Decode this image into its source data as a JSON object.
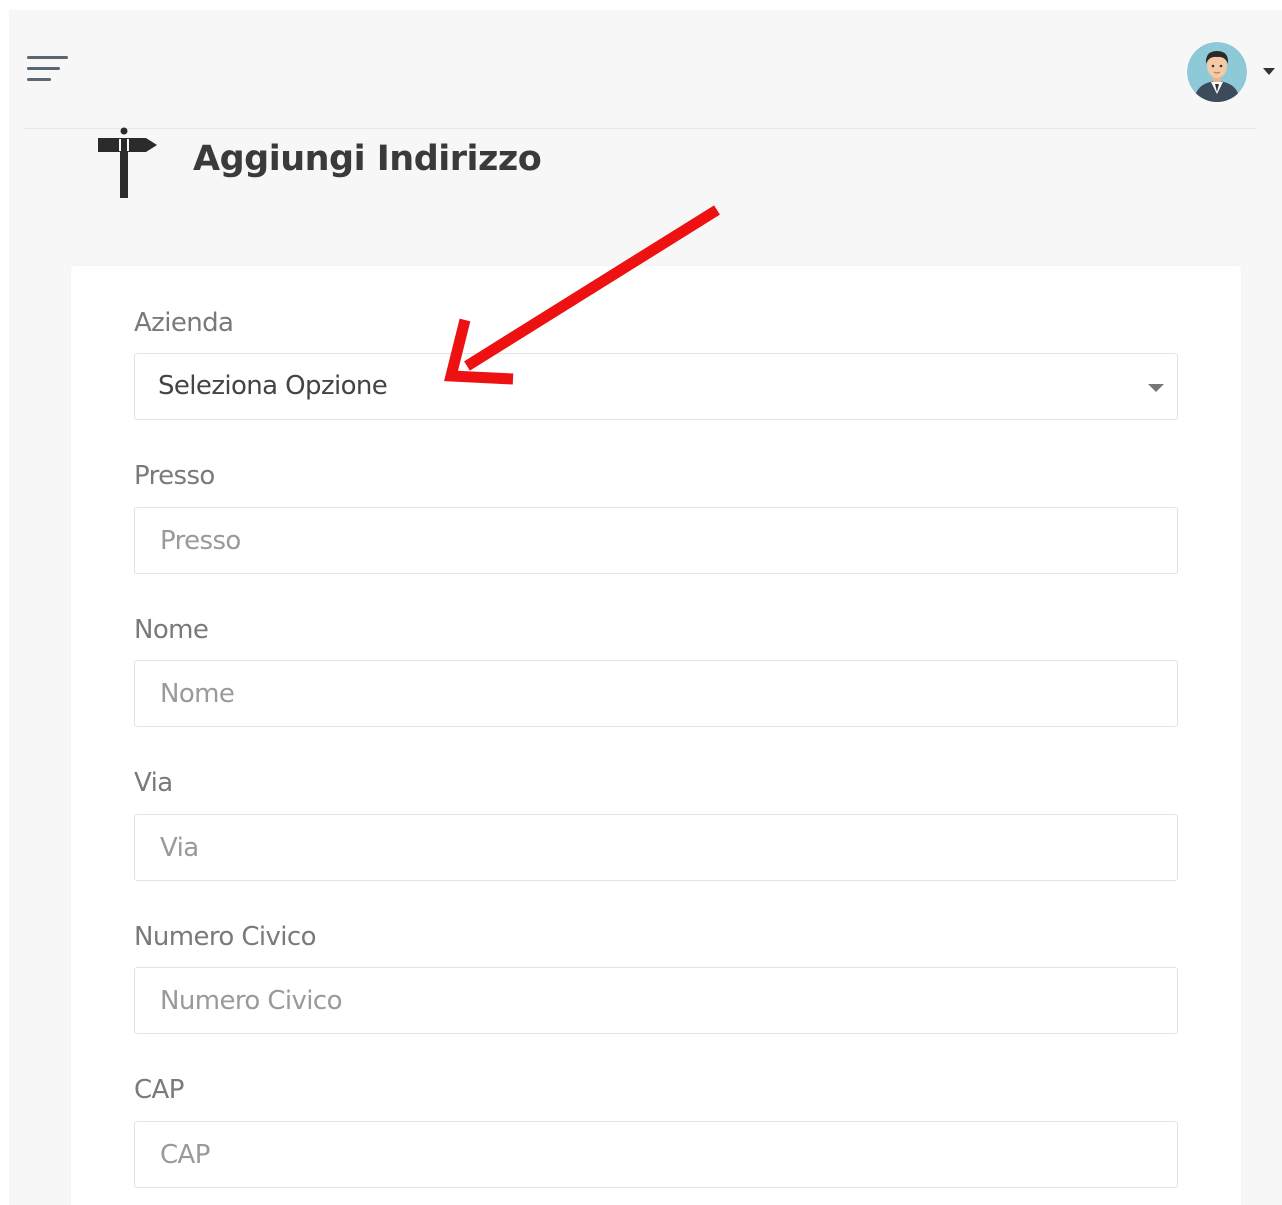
{
  "header": {
    "menu_toggle_icon": "hamburger-menu-icon",
    "user_avatar_icon": "user-avatar-icon",
    "user_menu_caret_icon": "caret-down-icon"
  },
  "page": {
    "title": "Aggiungi Indirizzo",
    "title_icon": "signpost-icon"
  },
  "annotation": {
    "icon": "red-arrow-icon",
    "color": "#ee1111"
  },
  "form": {
    "azienda": {
      "label": "Azienda",
      "selected": "Seleziona Opzione"
    },
    "presso": {
      "label": "Presso",
      "placeholder": "Presso",
      "value": ""
    },
    "nome": {
      "label": "Nome",
      "placeholder": "Nome",
      "value": ""
    },
    "via": {
      "label": "Via",
      "placeholder": "Via",
      "value": ""
    },
    "numero_civico": {
      "label": "Numero Civico",
      "placeholder": "Numero Civico",
      "value": ""
    },
    "cap": {
      "label": "CAP",
      "placeholder": "CAP",
      "value": ""
    }
  }
}
